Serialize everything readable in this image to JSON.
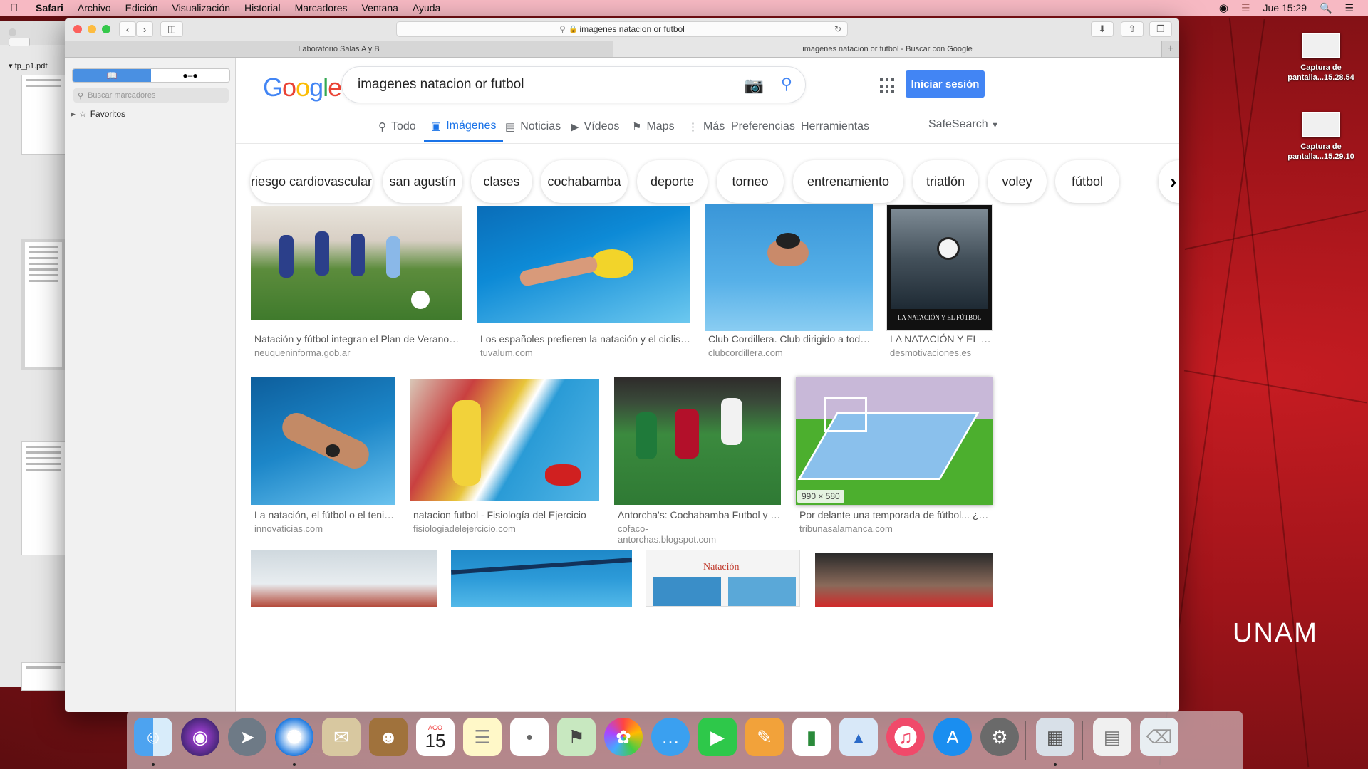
{
  "menubar": {
    "app": "Safari",
    "items": [
      "Archivo",
      "Edición",
      "Visualización",
      "Historial",
      "Marcadores",
      "Ventana",
      "Ayuda"
    ],
    "clock": "Jue 15:29"
  },
  "pdf_window": {
    "title": "fp_p1.pdf"
  },
  "safari": {
    "url": "imagenes natacion or futbol",
    "tabs": [
      {
        "label": "Laboratorio Salas A y B",
        "active": false
      },
      {
        "label": "imagenes natacion or futbol - Buscar con Google",
        "active": true
      }
    ],
    "sidebar": {
      "search_placeholder": "Buscar marcadores",
      "favorites_label": "Favoritos"
    }
  },
  "google": {
    "logo": "Google",
    "query": "imagenes natacion or futbol",
    "signin": "Iniciar sesión",
    "tabs": [
      {
        "label": "Todo",
        "icon": "search-icon"
      },
      {
        "label": "Imágenes",
        "icon": "image-icon",
        "active": true
      },
      {
        "label": "Noticias",
        "icon": "news-icon"
      },
      {
        "label": "Vídeos",
        "icon": "video-icon"
      },
      {
        "label": "Maps",
        "icon": "map-icon"
      },
      {
        "label": "Más",
        "icon": "more-vert-icon"
      },
      {
        "label": "Preferencias"
      },
      {
        "label": "Herramientas"
      }
    ],
    "safesearch": "SafeSearch",
    "chips": [
      "riesgo cardiovascular",
      "san agustín",
      "clases",
      "cochabamba",
      "deporte",
      "torneo",
      "entrenamiento",
      "triatlón",
      "voley",
      "fútbol"
    ],
    "results": [
      {
        "caption": "Natación y fútbol integran el Plan de Verano | Ne...",
        "domain": "neuqueninforma.gob.ar"
      },
      {
        "caption": "Los españoles prefieren la natación y el ciclismo ...",
        "domain": "tuvalum.com"
      },
      {
        "caption": "Club Cordillera. Club dirigido a todos ...",
        "domain": "clubcordillera.com"
      },
      {
        "caption": "LA NATACIÓN Y EL F...",
        "domain": "desmotivaciones.es",
        "img_text": "LA NATACIÓN Y EL FÚTBOL"
      },
      {
        "caption": "La natación, el fútbol o el tenis t...",
        "domain": "innovaticias.com"
      },
      {
        "caption": "natacion futbol - Fisiología del Ejercicio",
        "domain": "fisiologiadelejercicio.com"
      },
      {
        "caption": "Antorcha's: Cochabamba Futbol y Nat...",
        "domain": "cofaco-antorchas.blogspot.com"
      },
      {
        "caption": "Por delante una temporada de fútbol... ¿y na...",
        "domain": "tribunasalamanca.com",
        "dimensions": "990 × 580"
      }
    ],
    "row3_texts": {
      "natacion_banner": "Natación"
    }
  },
  "desktop": {
    "icons": [
      {
        "label1": "Captura de",
        "label2": "pantalla...15.28.54"
      },
      {
        "label1": "Captura de",
        "label2": "pantalla...15.29.10"
      }
    ],
    "watermark": "UNAM",
    "calendar": {
      "month": "AGO",
      "day": "15"
    }
  },
  "colors": {
    "menubar": "#f7b9c3",
    "google_blue": "#4285f4",
    "active_tab": "#1a73e8"
  }
}
